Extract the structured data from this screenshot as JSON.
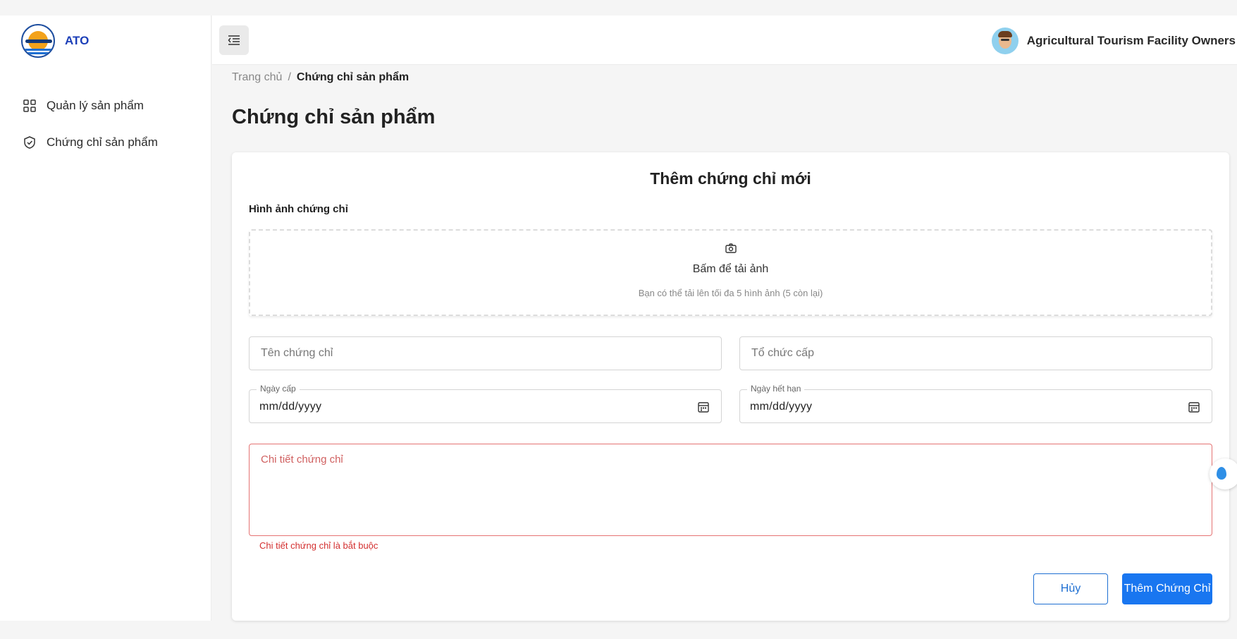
{
  "brand": {
    "name": "ATO"
  },
  "sidebar": {
    "items": [
      {
        "label": "Quản lý sản phẩm",
        "icon": "grid-icon"
      },
      {
        "label": "Chứng chỉ sản phẩm",
        "icon": "shield-check-icon"
      }
    ]
  },
  "header": {
    "menu_icon": "menu-collapse-icon",
    "user_name": "Agricultural Tourism Facility Owners"
  },
  "breadcrumb": {
    "home": "Trang chủ",
    "separator": "/",
    "current": "Chứng chỉ sản phẩm"
  },
  "page": {
    "title": "Chứng chỉ sản phẩm"
  },
  "form": {
    "title": "Thêm chứng chỉ mới",
    "image_section_label": "Hình ảnh chứng chỉ",
    "upload": {
      "icon": "camera-icon",
      "primary": "Bấm để tải ảnh",
      "hint": "Bạn có thể tải lên tối đa 5 hình ảnh (5 còn lại)"
    },
    "certificate_name": {
      "placeholder": "Tên chứng chỉ",
      "value": ""
    },
    "issuing_org": {
      "placeholder": "Tổ chức cấp",
      "value": ""
    },
    "issue_date": {
      "label": "Ngày cấp",
      "value": "mm/dd/yyyy"
    },
    "expiry_date": {
      "label": "Ngày hết hạn",
      "value": "mm/dd/yyyy"
    },
    "details": {
      "placeholder": "Chi tiết chứng chỉ",
      "value": ""
    },
    "details_error": "Chi tiết chứng chỉ là bắt buộc",
    "cancel_label": "Hủy",
    "submit_label": "Thêm Chứng Chỉ"
  },
  "colors": {
    "primary": "#1976f0",
    "error": "#d32f2f",
    "brand": "#1c3fb8"
  }
}
